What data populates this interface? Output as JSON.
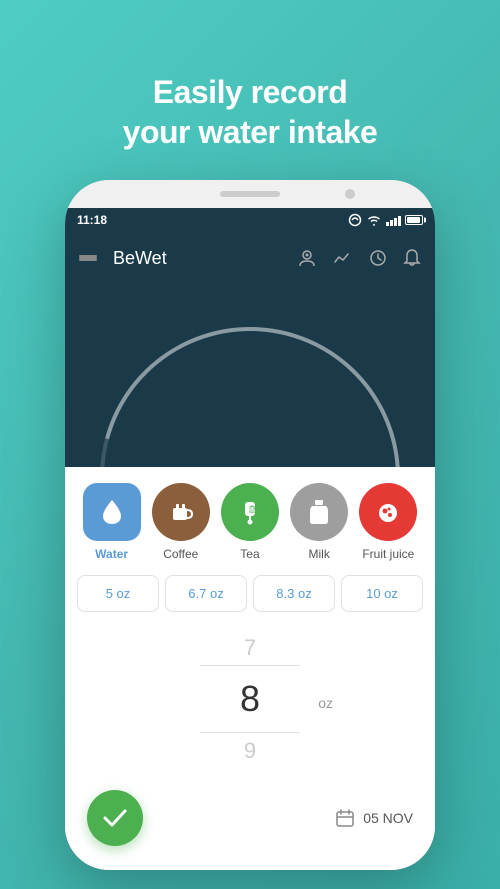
{
  "headline": {
    "line1": "Easily record",
    "line2": "your water intake"
  },
  "phone": {
    "status_bar": {
      "time": "11:18",
      "wifi": "●",
      "signal_bars": [
        4,
        6,
        8,
        10,
        12
      ],
      "battery_level": 80
    },
    "app_bar": {
      "title": "BeWet",
      "icons": [
        "user",
        "chart",
        "history",
        "bell"
      ]
    },
    "drinks": [
      {
        "id": "water",
        "label": "Water",
        "icon": "💧",
        "active": true
      },
      {
        "id": "coffee",
        "label": "Coffee",
        "icon": "☕",
        "active": false
      },
      {
        "id": "tea",
        "label": "Tea",
        "icon": "🛍",
        "active": false
      },
      {
        "id": "milk",
        "label": "Milk",
        "icon": "🥛",
        "active": false
      },
      {
        "id": "fruit-juice",
        "label": "Fruit juice",
        "icon": "🍓",
        "active": false
      }
    ],
    "quick_amounts": [
      {
        "label": "5 oz"
      },
      {
        "label": "6.7 oz"
      },
      {
        "label": "8.3 oz"
      },
      {
        "label": "10 oz"
      }
    ],
    "picker": {
      "prev": "7",
      "current": "8",
      "next": "9",
      "unit": "oz"
    },
    "action": {
      "confirm_icon": "✓",
      "date_icon": "📅",
      "date": "05 NOV"
    }
  }
}
